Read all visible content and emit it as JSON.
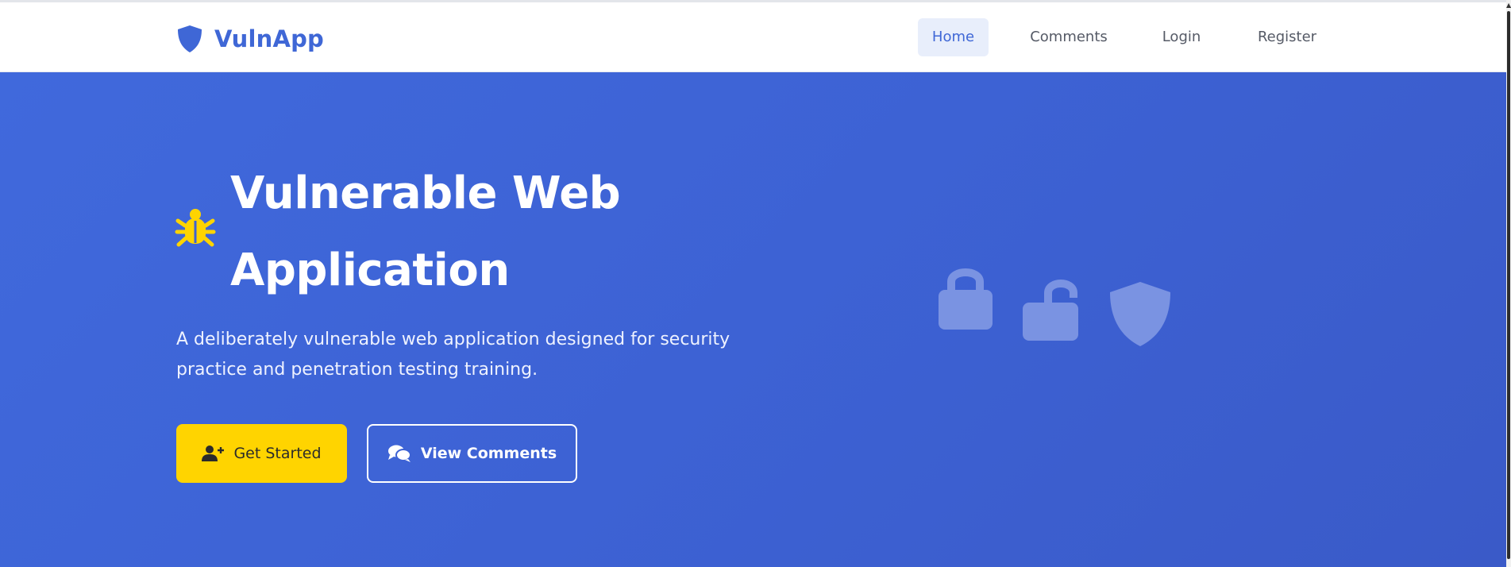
{
  "brand": {
    "name": "VulnApp",
    "icon": "shield-icon",
    "color": "#3f67d6"
  },
  "nav": {
    "items": [
      {
        "label": "Home",
        "active": true
      },
      {
        "label": "Comments",
        "active": false
      },
      {
        "label": "Login",
        "active": false
      },
      {
        "label": "Register",
        "active": false
      }
    ]
  },
  "hero": {
    "icon": "bug-icon",
    "title_line1": "Vulnerable Web",
    "title_line2": "Application",
    "subtitle": "A deliberately vulnerable web application designed for security practice and penetration testing training.",
    "primary_button": {
      "label": "Get Started",
      "icon": "user-plus-icon"
    },
    "secondary_button": {
      "label": "View Comments",
      "icon": "comments-icon"
    },
    "decorative_icons": [
      "lock-icon",
      "unlock-icon",
      "shield-icon"
    ]
  },
  "colors": {
    "accent": "#3f67d6",
    "hero_bg": "#3d62d4",
    "primary_button": "#ffd400",
    "bug": "#ffd400"
  }
}
